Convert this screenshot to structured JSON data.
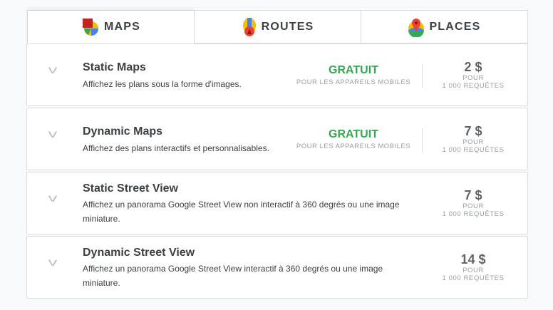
{
  "tabs": [
    {
      "label": "MAPS",
      "icon": "maps-icon"
    },
    {
      "label": "ROUTES",
      "icon": "routes-icon"
    },
    {
      "label": "PLACES",
      "icon": "places-icon"
    }
  ],
  "colors": {
    "free": "#34a853",
    "background": "#f8f9fa"
  },
  "products": [
    {
      "title": "Static Maps",
      "desc": "Affichez les plans sous la forme d'images.",
      "free": "GRATUIT",
      "free_sub": "POUR LES APPAREILS MOBILES",
      "price": "2 $",
      "per": "POUR",
      "unit": "1 000 REQUÊTES"
    },
    {
      "title": "Dynamic Maps",
      "desc": "Affichez des plans interactifs et personnalisables.",
      "free": "GRATUIT",
      "free_sub": "POUR LES APPAREILS MOBILES",
      "price": "7 $",
      "per": "POUR",
      "unit": "1 000 REQUÊTES"
    },
    {
      "title": "Static Street View",
      "desc": "Affichez un panorama Google Street View non interactif à 360 degrés ou une image miniature.",
      "price": "7 $",
      "per": "POUR",
      "unit": "1 000 REQUÊTES"
    },
    {
      "title": "Dynamic Street View",
      "desc": "Affichez un panorama Google Street View interactif à 360 degrés ou une image miniature.",
      "price": "14 $",
      "per": "POUR",
      "unit": "1 000 REQUÊTES"
    }
  ]
}
